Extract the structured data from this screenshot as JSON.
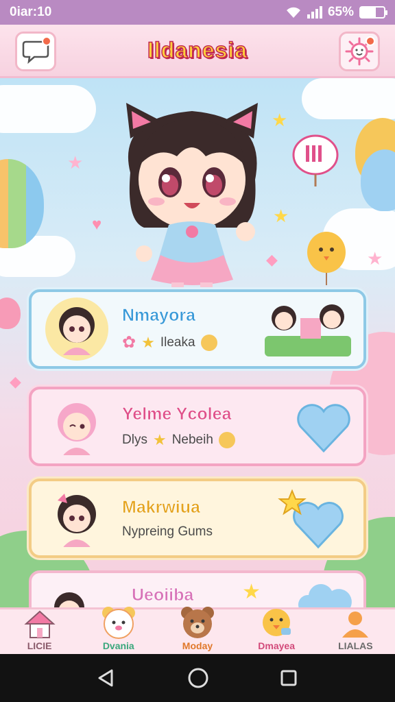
{
  "status_bar": {
    "time": "0iar:10",
    "battery": "65%",
    "battery_level": 0.65
  },
  "header": {
    "title": "Ildanesia",
    "chat_icon": "chat-bubble-icon",
    "notif_icon": "sun-mascot-icon"
  },
  "colors": {
    "accent_pink": "#f06e9b",
    "title_yellow": "#ffcf3c",
    "title_outline": "#c0284f",
    "blue": "#3a9ad8"
  },
  "cards": [
    {
      "title": "Nmayora",
      "sub": "Ileaka",
      "title_color": "#3a9ad8",
      "icons": [
        "flower-icon",
        "star-icon",
        "smiley-icon"
      ]
    },
    {
      "title": "Yelme Ycolea",
      "sub_left": "Dlys",
      "sub": "Nebeih",
      "title_color": "#e0508a",
      "icons": [
        "star-icon",
        "smiley-icon"
      ]
    },
    {
      "title": "Makrwiua",
      "sub": "Nypreing Gums",
      "title_color": "#e5a41f"
    },
    {
      "title": "Ueoiiba",
      "sub": "",
      "title_color": "#d873b8"
    }
  ],
  "nav": [
    {
      "label": "LICIE",
      "icon": "house-icon",
      "color": "#8a5a6a"
    },
    {
      "label": "Dvania",
      "icon": "bear-face-icon",
      "color": "#3aa77c"
    },
    {
      "label": "Moday",
      "icon": "brown-bear-icon",
      "color": "#e0782a"
    },
    {
      "label": "Dmayea",
      "icon": "duck-icon",
      "color": "#d24a7a"
    },
    {
      "label": "LIALAS",
      "icon": "person-icon",
      "color": "#6a6a6a"
    }
  ],
  "system_nav": {
    "back": "back-icon",
    "home": "home-circle-icon",
    "recents": "recents-square-icon"
  }
}
